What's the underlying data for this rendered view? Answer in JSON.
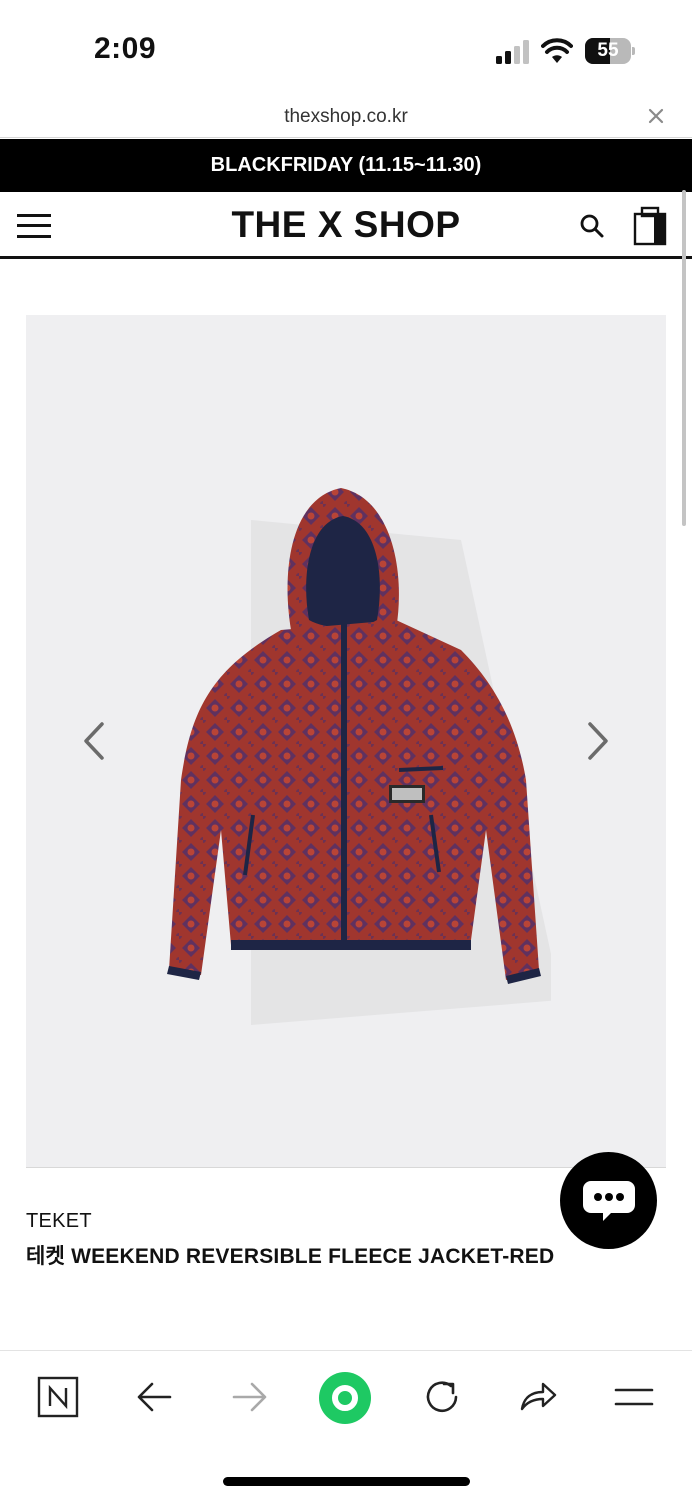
{
  "status_bar": {
    "time": "2:09",
    "battery_level": "55"
  },
  "browser": {
    "url": "thexshop.co.kr"
  },
  "promo": {
    "text": "BLACKFRIDAY (11.15~11.30)"
  },
  "header": {
    "logo": "THE X SHOP"
  },
  "product": {
    "brand": "TEKET",
    "name": "테켓 WEEKEND REVERSIBLE FLEECE JACKET-RED",
    "image_colors": {
      "fleece": "#a0362e",
      "pattern": "#4a2f6e",
      "trim": "#1e2545",
      "background": "#efeff1"
    }
  },
  "colors": {
    "accent_green": "#1ec963",
    "promo_bg": "#000000"
  },
  "icons": [
    "menu-icon",
    "search-icon",
    "bag-icon",
    "chevron-left-icon",
    "chevron-right-icon",
    "chat-icon",
    "naver-icon",
    "back-icon",
    "forward-icon",
    "home-icon",
    "refresh-icon",
    "share-icon",
    "tabs-menu-icon"
  ]
}
